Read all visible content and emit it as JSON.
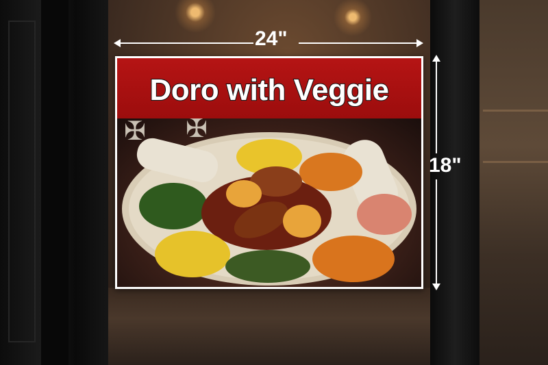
{
  "poster": {
    "headline": "Doro with Veggie",
    "banner_color": "#a91010"
  },
  "dimensions": {
    "width_label": "24\"",
    "height_label": "18\""
  },
  "photo": {
    "dishes": [
      "injera roll",
      "spinach",
      "yellow corn",
      "green lentils",
      "orange lentils",
      "chicken doro wat with eggs",
      "tomato salad",
      "injera roll"
    ]
  }
}
